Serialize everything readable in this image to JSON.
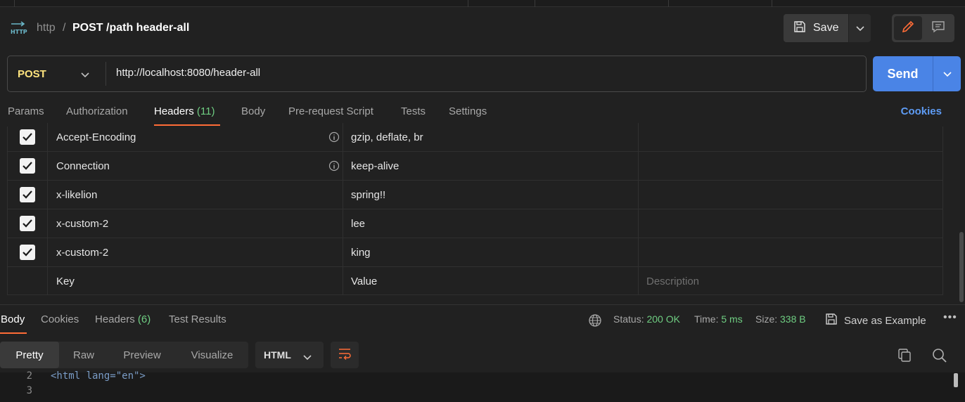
{
  "breadcrumb": {
    "icon": "http-icon",
    "protocol": "http",
    "separator": "/",
    "request_name": "POST /path header-all"
  },
  "toolbar": {
    "save_label": "Save",
    "icons": [
      "save-icon",
      "chevron-down-icon",
      "pencil-icon",
      "comment-icon"
    ]
  },
  "request": {
    "method": "POST",
    "url": "http://localhost:8080/header-all",
    "send_label": "Send"
  },
  "request_tabs": {
    "params": "Params",
    "authorization": "Authorization",
    "headers": "Headers",
    "headers_count": "(11)",
    "body": "Body",
    "pre_request": "Pre-request Script",
    "tests": "Tests",
    "settings": "Settings",
    "cookies": "Cookies",
    "active": "Headers"
  },
  "headers_table": {
    "rows": [
      {
        "key": "Accept-Encoding",
        "value": "gzip, deflate, br",
        "checked": true,
        "info": true
      },
      {
        "key": "Connection",
        "value": "keep-alive",
        "checked": true,
        "info": true
      },
      {
        "key": "x-likelion",
        "value": "spring!!",
        "checked": true,
        "info": false
      },
      {
        "key": "x-custom-2",
        "value": "lee",
        "checked": true,
        "info": false
      },
      {
        "key": "x-custom-2",
        "value": "king",
        "checked": true,
        "info": false
      }
    ],
    "placeholders": {
      "key": "Key",
      "value": "Value",
      "description": "Description"
    }
  },
  "response": {
    "tabs": {
      "body": "Body",
      "cookies": "Cookies",
      "headers": "Headers",
      "headers_count": "(6)",
      "test_results": "Test Results",
      "active": "Body"
    },
    "status_label": "Status:",
    "status_value": "200 OK",
    "time_label": "Time:",
    "time_value": "5 ms",
    "size_label": "Size:",
    "size_value": "338 B",
    "save_example": "Save as Example",
    "more": "•••",
    "formats": [
      "Pretty",
      "Raw",
      "Preview",
      "Visualize"
    ],
    "active_format": "Pretty",
    "language": "HTML",
    "code_lines": [
      {
        "number": "2",
        "text": "<html lang=\"en\">"
      },
      {
        "number": "3",
        "text": ""
      }
    ]
  },
  "colors": {
    "accent_orange": "#ff6c37",
    "send_blue": "#4a84e6",
    "method_yellow": "#ffe47e",
    "count_green": "#6fce82",
    "link_blue": "#5e9cf5"
  }
}
